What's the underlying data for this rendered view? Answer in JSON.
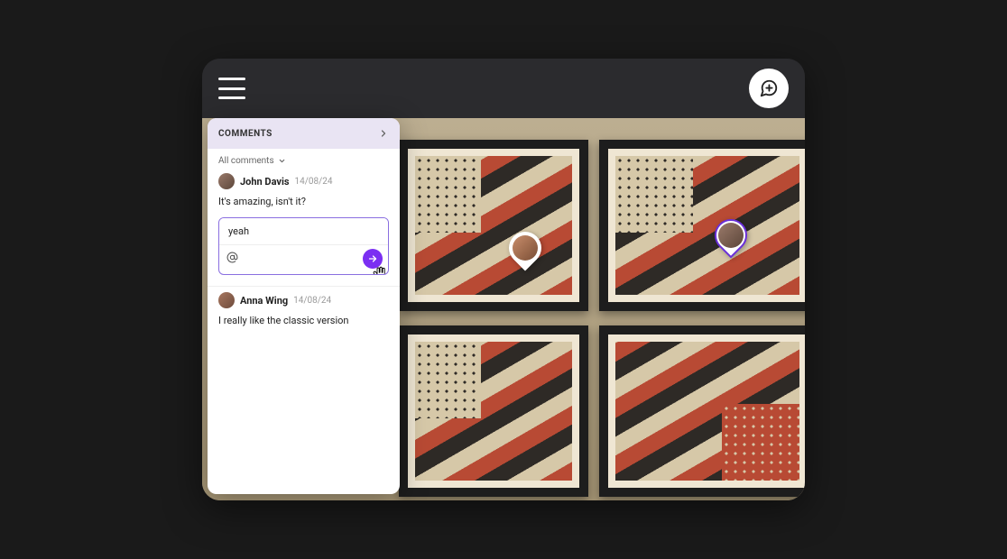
{
  "header": {
    "menu_icon": "hamburger-icon",
    "add_comment_icon": "speech-plus-icon"
  },
  "panel": {
    "title": "COMMENTS",
    "filter_label": "All comments"
  },
  "comments": [
    {
      "author": "John Davis",
      "date": "14/08/24",
      "body": "It's amazing, isn't it?",
      "reply_draft": "yeah"
    },
    {
      "author": "Anna Wing",
      "date": "14/08/24",
      "body": "I really like the classic version"
    }
  ],
  "colors": {
    "accent": "#7b2ff2",
    "panel_header": "#e9e4f3"
  }
}
